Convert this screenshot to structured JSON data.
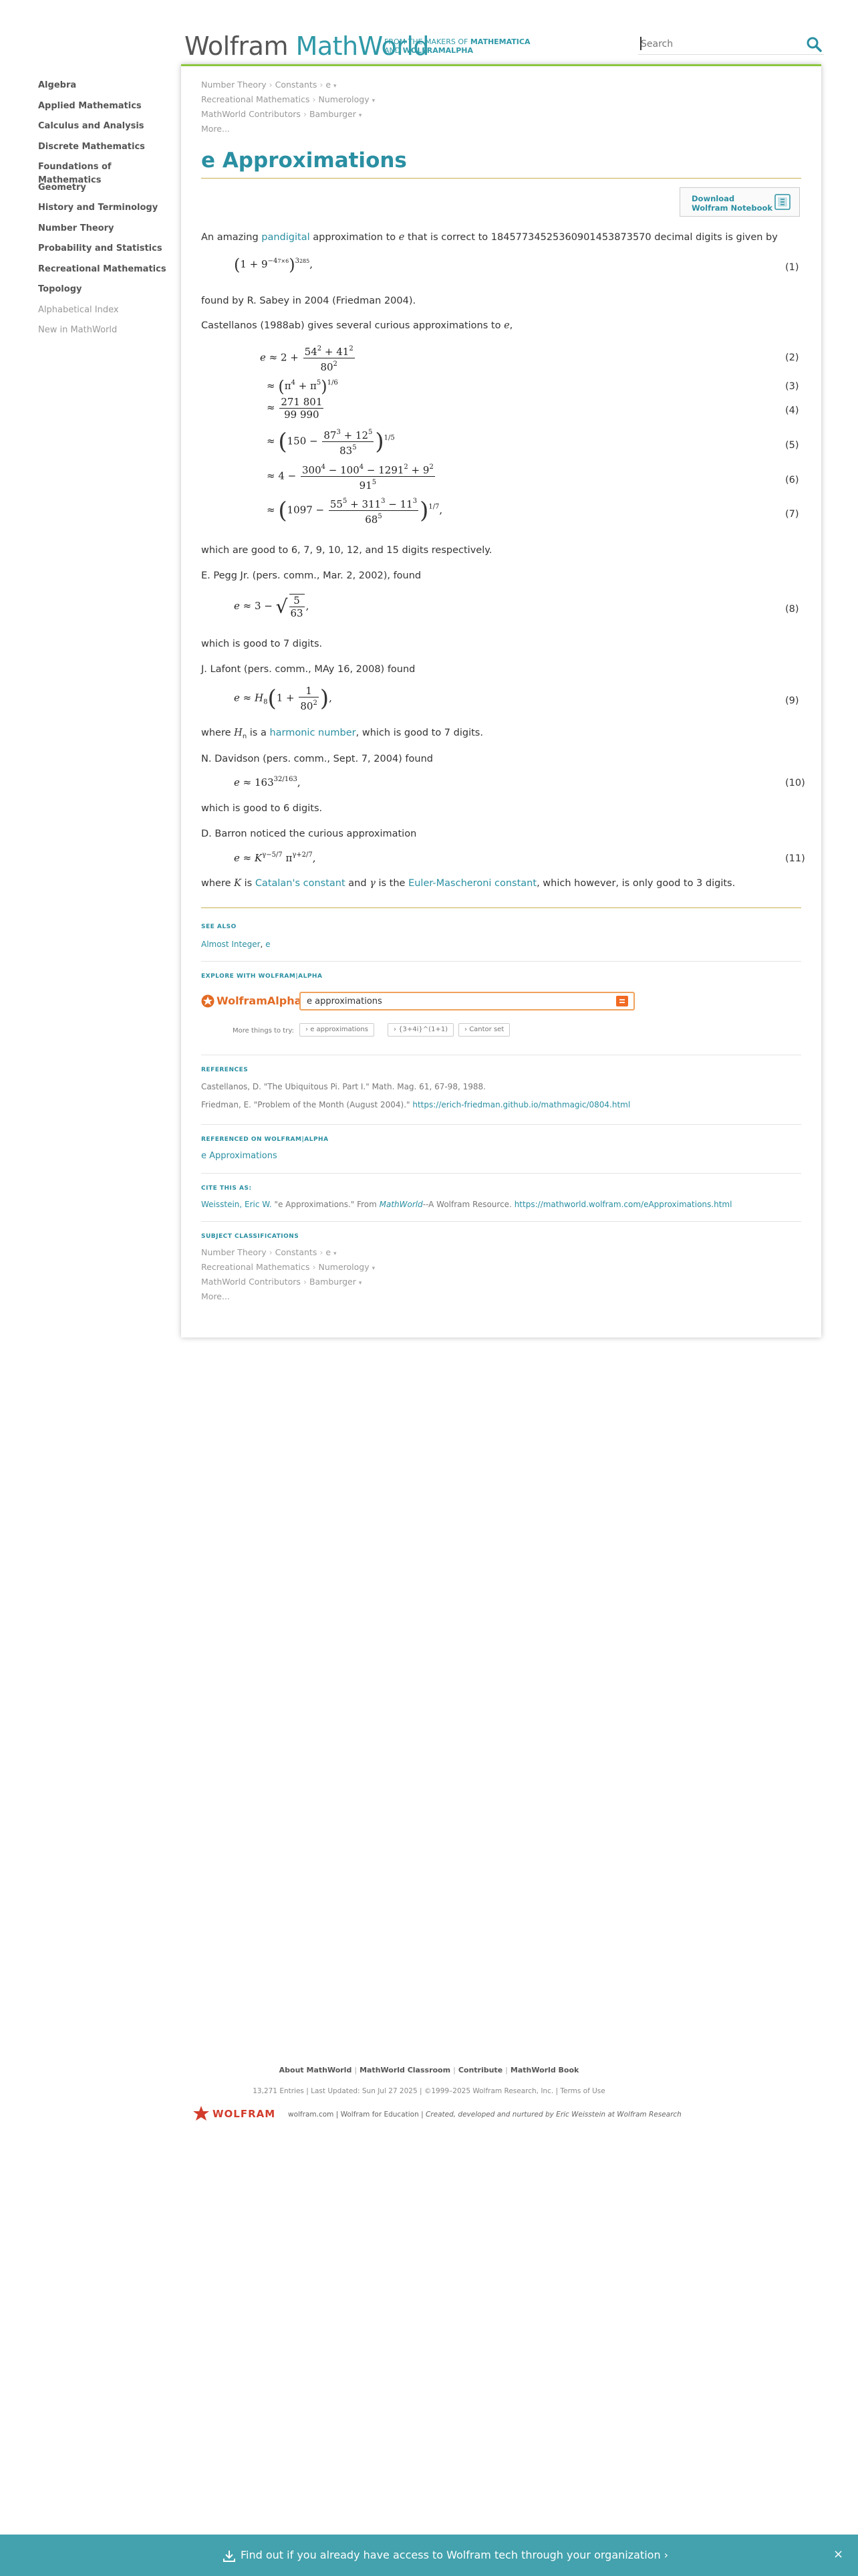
{
  "header": {
    "logo_wolfram": "Wolfram",
    "logo_mathworld": "MathWorld",
    "tagline_prefix": "FROM THE MAKERS OF",
    "tagline_mathematica": "MATHEMATICA",
    "tagline_and": "AND",
    "tagline_wolframalpha": "WOLFRAMALPHA",
    "search_placeholder": "Search"
  },
  "sidebar": {
    "items": [
      {
        "label": "Algebra"
      },
      {
        "label": "Applied Mathematics"
      },
      {
        "label": "Calculus and Analysis"
      },
      {
        "label": "Discrete Mathematics"
      },
      {
        "label": "Foundations of Mathematics"
      },
      {
        "label": "Geometry"
      },
      {
        "label": "History and Terminology"
      },
      {
        "label": "Number Theory"
      },
      {
        "label": "Probability and Statistics"
      },
      {
        "label": "Recreational Mathematics"
      },
      {
        "label": "Topology"
      },
      {
        "label": "Alphabetical Index"
      },
      {
        "label": "New in MathWorld"
      }
    ]
  },
  "breadcrumbs": [
    [
      "Number Theory",
      "Constants",
      "e"
    ],
    [
      "Recreational Mathematics",
      "Numerology"
    ],
    [
      "MathWorld Contributors",
      "Bamburger"
    ]
  ],
  "more_label": "More...",
  "title": "e Approximations",
  "download": {
    "line1": "Download",
    "line2": "Wolfram Notebook"
  },
  "body": {
    "p1_a": "An amazing ",
    "p1_link": "pandigital",
    "p1_b": " approximation to ",
    "p1_c": " that is correct to 18457734525360901453873570 decimal digits is given by",
    "p2": "found by R. Sabey in 2004 (Friedman 2004).",
    "p3": "Castellanos (1988ab) gives several curious approximations to ",
    "p4": "which are good to 6, 7, 9, 10, 12, and 15 digits respectively.",
    "p5": "E. Pegg Jr. (pers. comm., Mar. 2, 2002), found",
    "p6": "which is good to 7 digits.",
    "p7": "J. Lafont (pers. comm., MAy 16, 2008) found",
    "p8_a": "where ",
    "p8_b": " is a ",
    "p8_link": "harmonic number",
    "p8_c": ", which is good to 7 digits.",
    "p9": "N. Davidson (pers. comm., Sept. 7, 2004) found",
    "p10": "which is good to 6 digits.",
    "p11": "D. Barron noticed the curious approximation",
    "p12_a": "where ",
    "p12_b": " is ",
    "p12_link1": "Catalan's constant",
    "p12_c": " and ",
    "p12_d": " is the ",
    "p12_link2": "Euler-Mascheroni constant",
    "p12_e": ", which however, is only good to 3 digits."
  },
  "equation_numbers": [
    "(1)",
    "(2)",
    "(3)",
    "(4)",
    "(5)",
    "(6)",
    "(7)",
    "(8)",
    "(9)",
    "(10)",
    "(11)"
  ],
  "see_also": {
    "heading": "SEE ALSO",
    "link1": "Almost Integer",
    "link2": "e"
  },
  "explore": {
    "heading": "EXPLORE WITH WOLFRAM|ALPHA",
    "logo_text": "WolframAlpha",
    "query": "e approximations",
    "try_label": "More things to try:",
    "chips": [
      "e approximations",
      "{3+4i}^(1+1)",
      "Cantor set"
    ]
  },
  "references": {
    "heading": "REFERENCES",
    "ref1": "Castellanos, D. \"The Ubiquitous Pi. Part I.\" Math. Mag. 61, 67-98, 1988.",
    "ref2_a": "Friedman, E. \"Problem of the Month (August 2004).\" ",
    "ref2_link": "https://erich-friedman.github.io/mathmagic/0804.html"
  },
  "referenced_on": {
    "heading": "REFERENCED ON WOLFRAM|ALPHA",
    "link": "e Approximations"
  },
  "cite": {
    "heading": "CITE THIS AS:",
    "author": "Weisstein, Eric W.",
    "text_a": " \"e Approximations.\" From ",
    "mathworld": "MathWorld",
    "text_b": "--A Wolfram Resource. ",
    "url": "https://mathworld.wolfram.com/eApproximations.html"
  },
  "classifications": {
    "heading": "SUBJECT CLASSIFICATIONS"
  },
  "footer": {
    "links": [
      "About MathWorld",
      "MathWorld Classroom",
      "Contribute",
      "MathWorld Book"
    ],
    "meta": "13,271 Entries  |  Last Updated: Sun Jul 27 2025  |  ©1999–2025 Wolfram Research, Inc.  |  Terms of Use",
    "brand": "WOLFRAM",
    "brand_links": "wolfram.com  |  Wolfram for Education  |  ",
    "brand_italic": "Created, developed and nurtured by Eric Weisstein at Wolfram Research"
  },
  "banner": {
    "text": "Find out if you already have access to Wolfram tech through your organization ›",
    "close": "×"
  },
  "colors": {
    "accent_teal": "#2a8fa2",
    "rule_green": "#8cc63f",
    "rule_olive": "#c8b14f",
    "wolframalpha_orange": "#e26b25",
    "banner_bg": "#43a2ad",
    "wolfram_red": "#d23c2c"
  }
}
